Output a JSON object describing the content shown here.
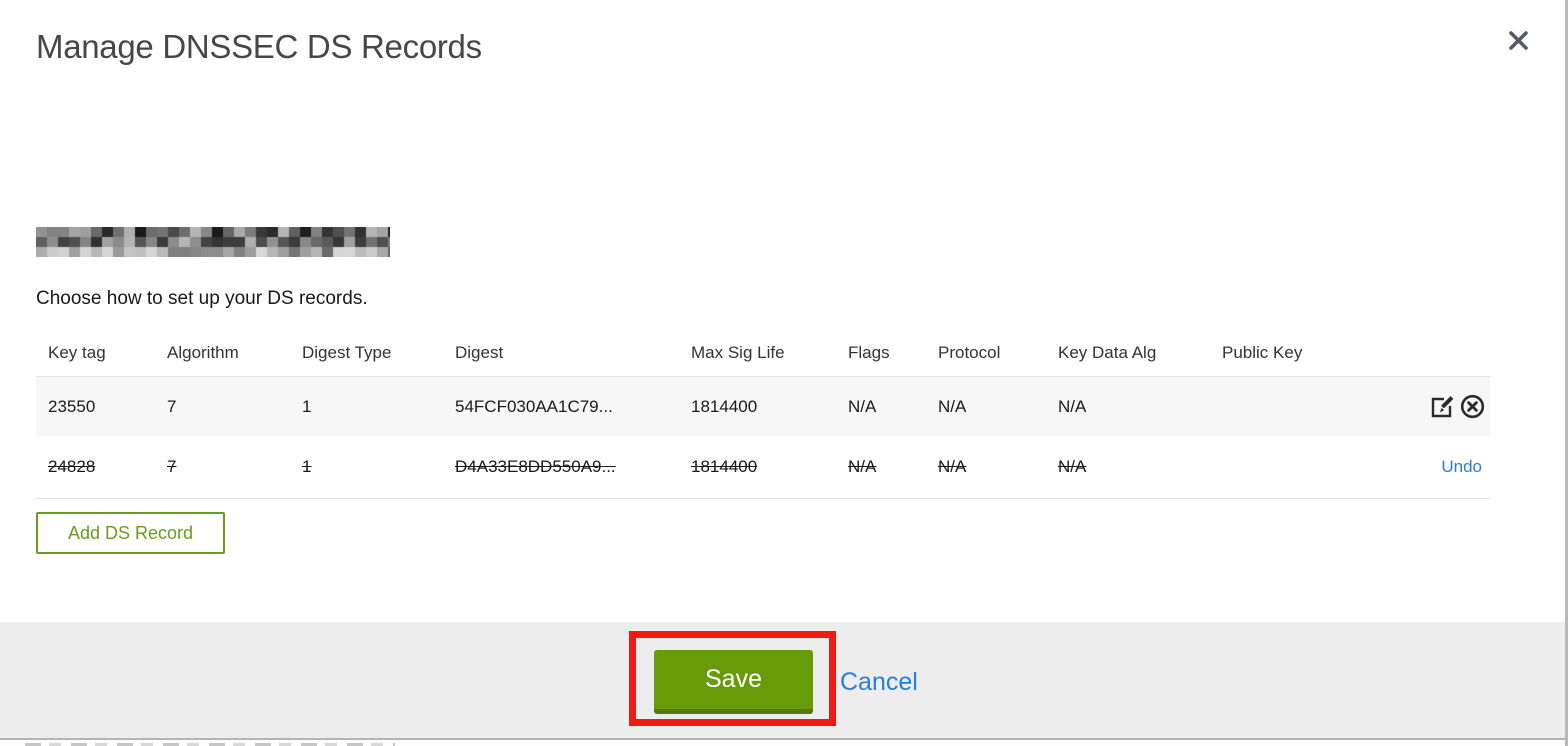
{
  "modal": {
    "title": "Manage DNSSEC DS Records",
    "instruction": "Choose how to set up your DS records.",
    "add_button_label": "Add DS Record",
    "save_label": "Save",
    "cancel_label": "Cancel",
    "domain_redacted": true
  },
  "table": {
    "columns": [
      "Key tag",
      "Algorithm",
      "Digest Type",
      "Digest",
      "Max Sig Life",
      "Flags",
      "Protocol",
      "Key Data Alg",
      "Public Key"
    ],
    "rows": [
      {
        "key_tag": "23550",
        "algorithm": "7",
        "digest_type": "1",
        "digest": "54FCF030AA1C79...",
        "max_sig_life": "1814400",
        "flags": "N/A",
        "protocol": "N/A",
        "key_data_alg": "N/A",
        "public_key": "",
        "state": "normal"
      },
      {
        "key_tag": "24828",
        "algorithm": "7",
        "digest_type": "1",
        "digest": "D4A33E8DD550A9...",
        "max_sig_life": "1814400",
        "flags": "N/A",
        "protocol": "N/A",
        "key_data_alg": "N/A",
        "public_key": "",
        "state": "deleted",
        "undo_label": "Undo"
      }
    ]
  },
  "colors": {
    "accent_green": "#689b0a",
    "outline_green": "#6b9b1e",
    "link_blue": "#2b7cdf",
    "annotation_red": "#ee1b15",
    "footer_gray": "#ededed",
    "row_stripe": "#f7f7f7"
  }
}
